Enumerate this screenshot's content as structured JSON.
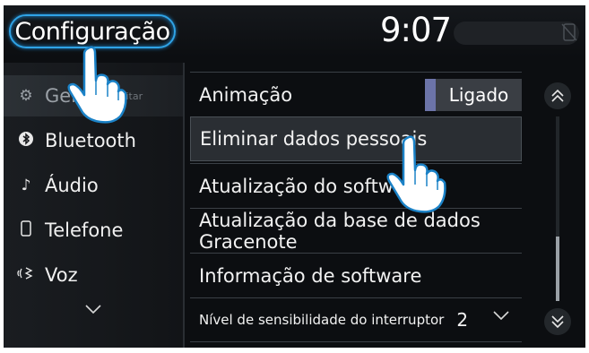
{
  "header": {
    "title": "Configuração",
    "clock": "9:07"
  },
  "sidebar": {
    "items": [
      {
        "label": "Geral",
        "icon": "gear-icon",
        "active": true,
        "hint": "Editar"
      },
      {
        "label": "Bluetooth",
        "icon": "bluetooth-icon"
      },
      {
        "label": "Áudio",
        "icon": "music-note-icon"
      },
      {
        "label": "Telefone",
        "icon": "phone-icon"
      },
      {
        "label": "Voz",
        "icon": "voice-icon"
      }
    ],
    "more_icon": "chevron-down-icon"
  },
  "list": {
    "rows": [
      {
        "label": "Animação",
        "toggle": "Ligado"
      },
      {
        "label": "Eliminar dados pessoais",
        "selected": true
      },
      {
        "label": "Atualização do software"
      },
      {
        "label": "Atualização da base de dados Gracenote"
      },
      {
        "label": "Informação de software"
      },
      {
        "label": "Nível de sensibilidade do interruptor",
        "value": "2"
      }
    ]
  },
  "colors": {
    "accent": "#2fa3e6",
    "toggle_bar": "#6c74a8",
    "background": "#0c0e11"
  }
}
